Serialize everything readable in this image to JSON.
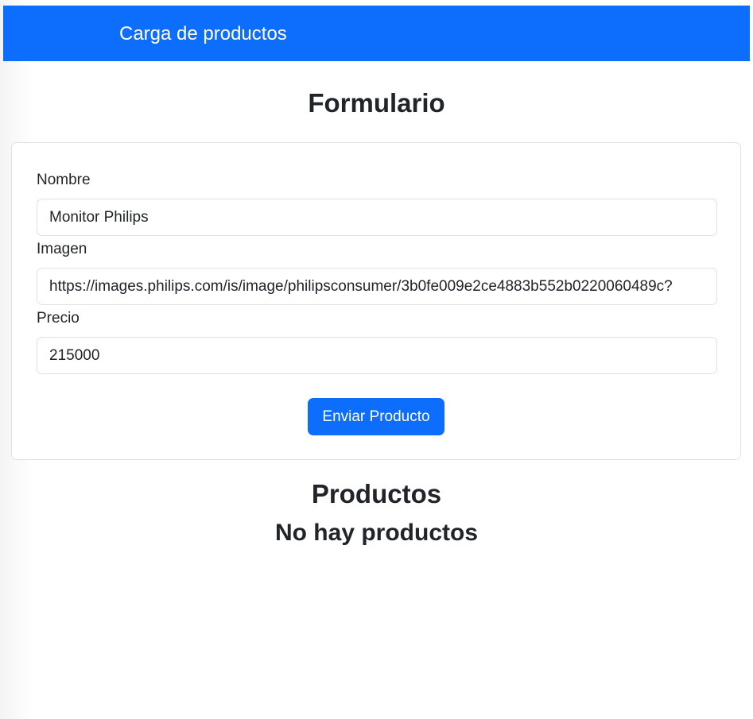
{
  "navbar": {
    "brand": "Carga de productos"
  },
  "form_section": {
    "title": "Formulario",
    "fields": [
      {
        "label": "Nombre",
        "value": "Monitor Philips"
      },
      {
        "label": "Imagen",
        "value": "https://images.philips.com/is/image/philipsconsumer/3b0fe009e2ce4883b552b0220060489c?"
      },
      {
        "label": "Precio",
        "value": "215000"
      }
    ],
    "submit_label": "Enviar Producto"
  },
  "products_section": {
    "title": "Productos",
    "empty_message": "No hay productos"
  },
  "colors": {
    "primary": "#0d6efd",
    "text": "#212529",
    "border": "#dee2e6"
  }
}
